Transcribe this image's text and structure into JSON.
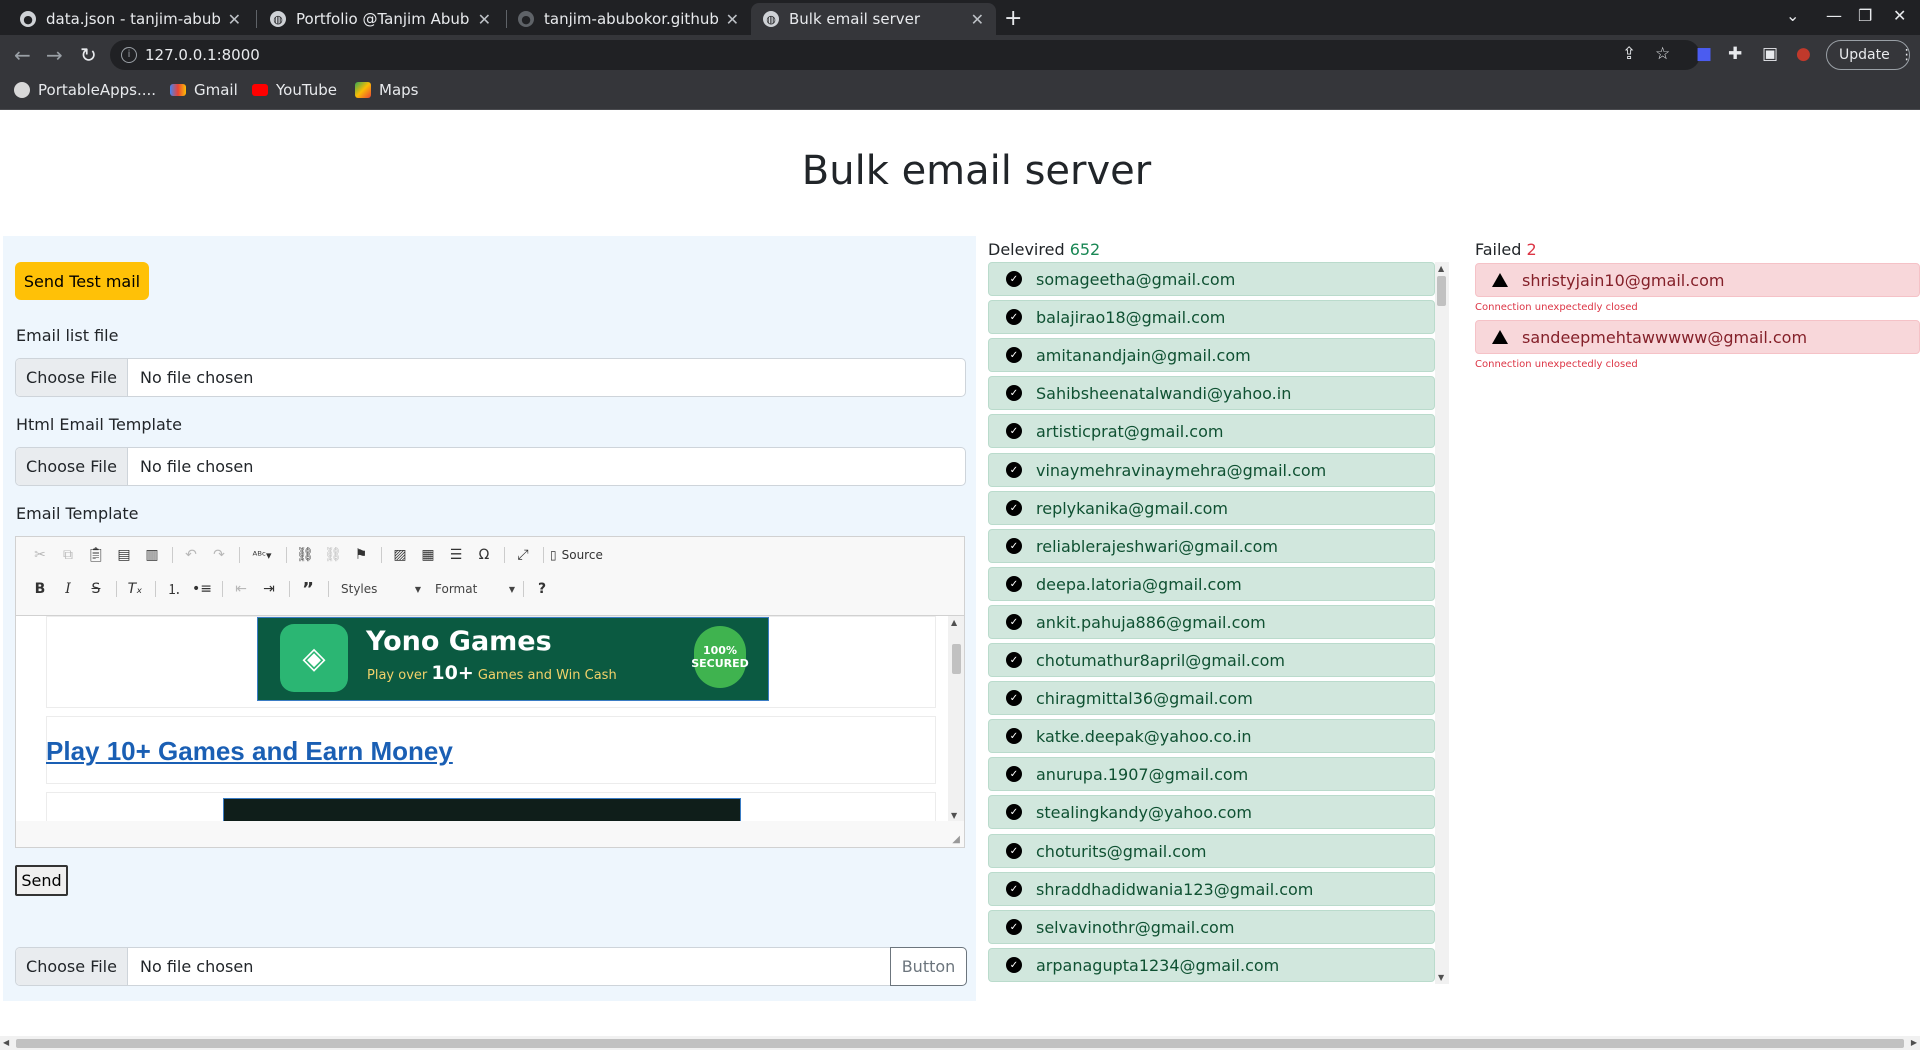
{
  "browser": {
    "tabs": [
      {
        "title": "data.json - tanjim-abubokor"
      },
      {
        "title": "Portfolio @Tanjim Abubokor"
      },
      {
        "title": "tanjim-abubokor.github.io"
      },
      {
        "title": "Bulk email server"
      }
    ],
    "url": "127.0.0.1:8000",
    "update_label": "Update",
    "bookmarks": [
      {
        "label": "PortableApps...."
      },
      {
        "label": "Gmail"
      },
      {
        "label": "YouTube"
      },
      {
        "label": "Maps"
      }
    ]
  },
  "page": {
    "title": "Bulk email server"
  },
  "form": {
    "send_test_label": "Send Test mail",
    "email_list_label": "Email list file",
    "html_template_label": "Html Email Template",
    "email_template_label": "Email Template",
    "choose_file_label": "Choose File",
    "no_file_label": "No file chosen",
    "send_label": "Send",
    "button_label": "Button"
  },
  "editor": {
    "source_label": "Source",
    "styles_label": "Styles",
    "format_label": "Format",
    "help_label": "?",
    "banner_title": "Yono Games",
    "banner_subtitle_pre": "Play over ",
    "banner_subtitle_num": "10+",
    "banner_subtitle_post": " Games and Win Cash",
    "banner_badge": "100% SECURED",
    "link_text": "Play 10+ Games and Earn Money"
  },
  "delivered": {
    "label": "Delevired",
    "count": "652",
    "items": [
      "somageetha@gmail.com",
      "balajirao18@gmail.com",
      "amitanandjain@gmail.com",
      "Sahibsheenatalwandi@yahoo.in",
      "artisticprat@gmail.com",
      "vinaymehravinaymehra@gmail.com",
      "replykanika@gmail.com",
      "reliablerajeshwari@gmail.com",
      "deepa.latoria@gmail.com",
      "ankit.pahuja886@gmail.com",
      "chotumathur8april@gmail.com",
      "chiragmittal36@gmail.com",
      "katke.deepak@yahoo.co.in",
      "anurupa.1907@gmail.com",
      "stealingkandy@yahoo.com",
      "choturits@gmail.com",
      "shraddhadidwania123@gmail.com",
      "selvavinothr@gmail.com",
      "arpanagupta1234@gmail.com"
    ]
  },
  "failed": {
    "label": "Failed",
    "count": "2",
    "items": [
      {
        "email": "shristyjain10@gmail.com",
        "error": "Connection unexpectedly closed"
      },
      {
        "email": "sandeepmehtawwwww@gmail.com",
        "error": "Connection unexpectedly closed"
      }
    ]
  },
  "colors": {
    "accent_yellow": "#ffc107",
    "success_bg": "#d1e7dd",
    "danger_bg": "#f8d7da",
    "panel_bg": "#eef6fd"
  }
}
